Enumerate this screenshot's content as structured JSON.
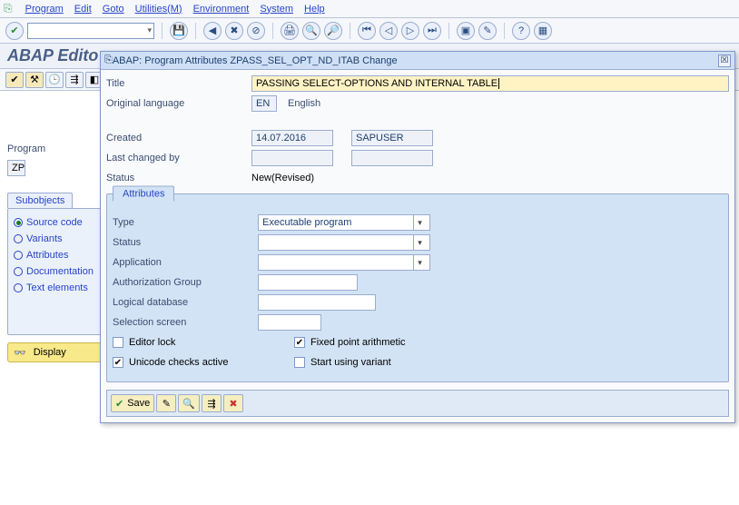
{
  "menu": {
    "program": "Program",
    "edit": "Edit",
    "goto": "Goto",
    "utilities": "Utilities(M)",
    "environment": "Environment",
    "system": "System",
    "help": "Help"
  },
  "title": "ABAP Edito",
  "program_label": "Program",
  "program_value": "ZP",
  "subobjects": {
    "tab": "Subobjects",
    "source": "Source code",
    "variants": "Variants",
    "attributes": "Attributes",
    "documentation": "Documentation",
    "textelements": "Text elements"
  },
  "display_btn": "Display",
  "dialog": {
    "title": "ABAP: Program Attributes ZPASS_SEL_OPT_ND_ITAB Change",
    "title_label": "Title",
    "title_value": "PASSING SELECT-OPTIONS AND INTERNAL TABLE",
    "orig_lang": "Original language",
    "orig_lang_code": "EN",
    "orig_lang_name": "English",
    "created_label": "Created",
    "created_date": "14.07.2016",
    "created_by": "SAPUSER",
    "lastchg": "Last changed by",
    "status_label": "Status",
    "status_value": "New(Revised)",
    "group": "Attributes",
    "type_label": "Type",
    "type_value": "Executable program",
    "status2": "Status",
    "application": "Application",
    "auth": "Authorization Group",
    "ldb": "Logical database",
    "selscr": "Selection screen",
    "editorlock": "Editor lock",
    "fixedpoint": "Fixed point arithmetic",
    "unicode": "Unicode checks active",
    "startvar": "Start using variant",
    "save": "Save"
  }
}
